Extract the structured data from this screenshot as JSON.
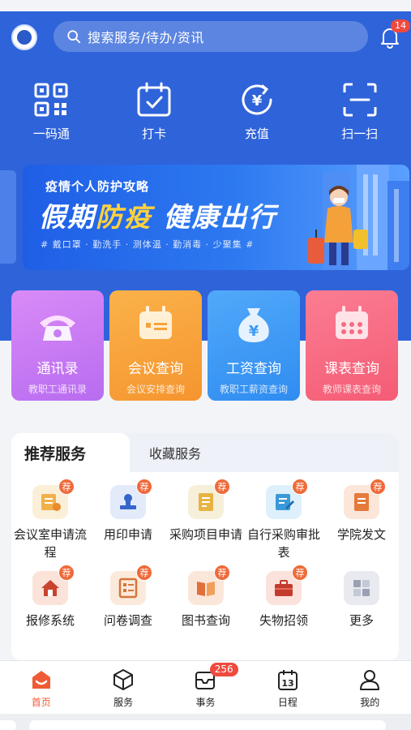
{
  "header": {
    "search_placeholder": "搜索服务/待办/资讯",
    "notification_count": "14"
  },
  "quick_actions": [
    {
      "label": "一码通",
      "icon": "qr-code-icon"
    },
    {
      "label": "打卡",
      "icon": "calendar-check-icon"
    },
    {
      "label": "充值",
      "icon": "yuan-recharge-icon"
    },
    {
      "label": "扫一扫",
      "icon": "scan-icon"
    }
  ],
  "banner": {
    "subtitle": "疫情个人防护攻略",
    "title_part1": "假期",
    "title_highlight": "防疫",
    "title_part2": " 健康出行",
    "tags": "# 戴口罩 · 勤洗手 · 测体温 · 勤消毒 · 少聚集 #"
  },
  "feature_cards": [
    {
      "title": "通讯录",
      "subtitle": "教职工通讯录",
      "icon": "telephone-icon",
      "color": "#c97af0"
    },
    {
      "title": "会议查询",
      "subtitle": "会议安排查询",
      "icon": "meeting-board-icon",
      "color": "#f7a23d"
    },
    {
      "title": "工资查询",
      "subtitle": "教职工薪资查询",
      "icon": "money-bag-icon",
      "color": "#3e9bf5"
    },
    {
      "title": "课表查询",
      "subtitle": "教师课表查询",
      "icon": "schedule-icon",
      "color": "#f76a82"
    }
  ],
  "services": {
    "tab_recommended": "推荐服务",
    "tab_favorites": "收藏服务",
    "tag_text": "荐",
    "items": [
      {
        "label": "会议室申请流程",
        "icon": "meeting-room-icon"
      },
      {
        "label": "用印申请",
        "icon": "seal-icon"
      },
      {
        "label": "采购项目申请",
        "icon": "purchase-doc-icon"
      },
      {
        "label": "自行采购审批表",
        "icon": "approval-form-icon"
      },
      {
        "label": "学院发文",
        "icon": "document-icon"
      },
      {
        "label": "报修系统",
        "icon": "house-repair-icon"
      },
      {
        "label": "问卷调查",
        "icon": "survey-icon"
      },
      {
        "label": "图书查询",
        "icon": "book-icon"
      },
      {
        "label": "失物招领",
        "icon": "lost-found-icon"
      },
      {
        "label": "更多",
        "icon": "more-grid-icon"
      }
    ]
  },
  "tabbar": [
    {
      "label": "首页",
      "icon": "home-icon",
      "active": true
    },
    {
      "label": "服务",
      "icon": "cube-icon",
      "active": false
    },
    {
      "label": "事务",
      "icon": "inbox-icon",
      "active": false,
      "badge": "256"
    },
    {
      "label": "日程",
      "icon": "calendar-icon",
      "active": false
    },
    {
      "label": "我的",
      "icon": "user-icon",
      "active": false
    }
  ],
  "colors": {
    "hero_blue": "#2f63d9",
    "accent_orange": "#ef5b34",
    "badge_red": "#ef4a3f"
  }
}
